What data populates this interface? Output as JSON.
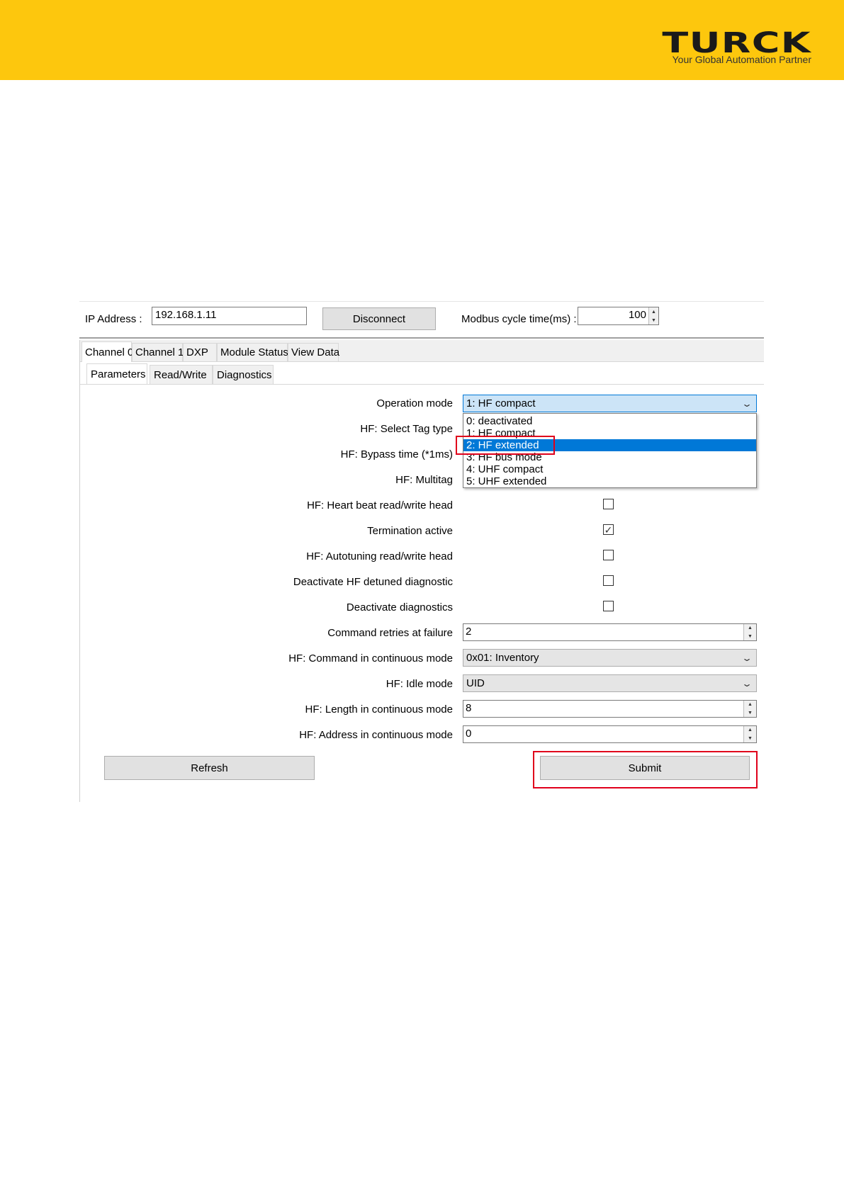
{
  "header": {
    "brand": "TURCK",
    "tagline": "Your Global Automation Partner",
    "colors": {
      "banner": "#FDC70D",
      "selection": "#0078d7",
      "highlight_box": "#e0001b"
    }
  },
  "connection": {
    "ip_label": "IP Address :",
    "ip_value": "192.168.1.11",
    "disconnect_label": "Disconnect",
    "cycle_label": "Modbus cycle time(ms) :",
    "cycle_value": "100"
  },
  "tabs": [
    "Channel 0",
    "Channel 1",
    "DXP",
    "Module Status",
    "View Data"
  ],
  "subtabs": [
    "Parameters",
    "Read/Write",
    "Diagnostics"
  ],
  "form": {
    "operation_mode": {
      "label": "Operation mode",
      "value": "1: HF compact",
      "options": [
        "0: deactivated",
        "1: HF compact",
        "2: HF extended",
        "3: HF bus mode",
        "4: UHF compact",
        "5: UHF extended"
      ],
      "highlighted_option_index": 2
    },
    "select_tag_type_label": "HF: Select Tag type",
    "bypass_time_label": "HF: Bypass time (*1ms)",
    "multitag_label": "HF: Multitag",
    "heartbeat": {
      "label": "HF: Heart beat read/write head",
      "checked": false
    },
    "termination": {
      "label": "Termination active",
      "checked": true
    },
    "autotuning": {
      "label": "HF: Autotuning read/write head",
      "checked": false
    },
    "deactivate_detuned": {
      "label": "Deactivate HF detuned diagnostic",
      "checked": false
    },
    "deactivate_diag": {
      "label": "Deactivate diagnostics",
      "checked": false
    },
    "retries": {
      "label": "Command retries at failure",
      "value": "2"
    },
    "continuous_cmd": {
      "label": "HF: Command in continuous mode",
      "value": "0x01: Inventory"
    },
    "idle_mode": {
      "label": "HF: Idle mode",
      "value": "UID"
    },
    "length": {
      "label": "HF: Length in continuous mode",
      "value": "8"
    },
    "address": {
      "label": "HF: Address in continuous mode",
      "value": "0"
    }
  },
  "actions": {
    "refresh_label": "Refresh",
    "submit_label": "Submit"
  }
}
